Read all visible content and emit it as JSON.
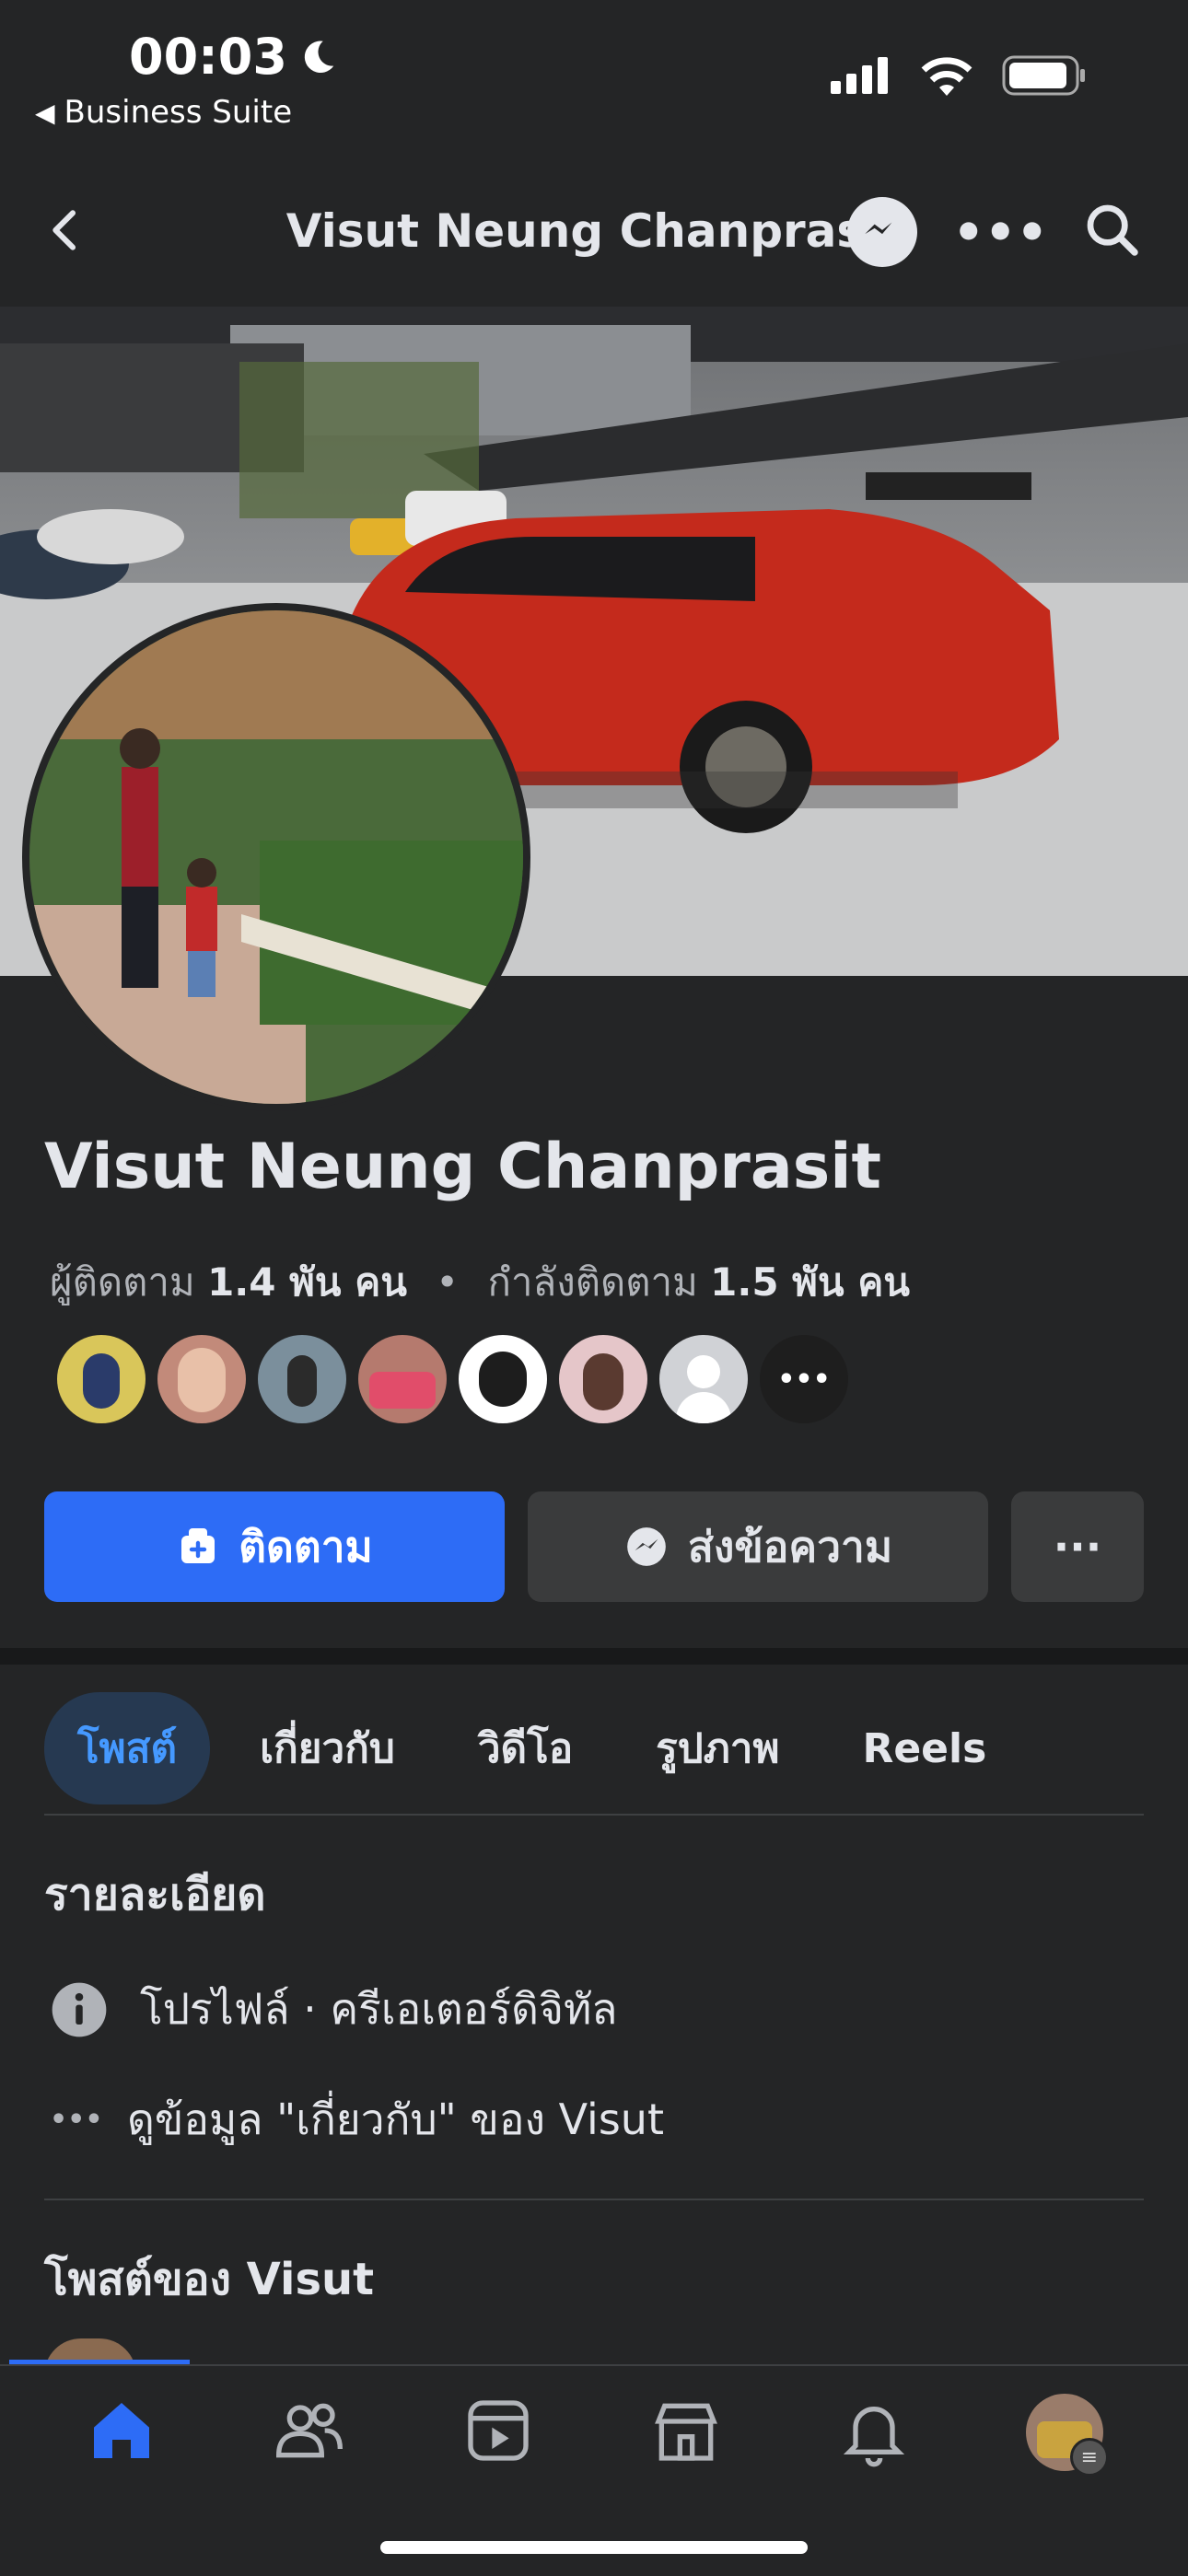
{
  "status_bar": {
    "time": "00:03",
    "back_app": "Business Suite"
  },
  "nav": {
    "title": "Visut Neung Chanprasit"
  },
  "profile": {
    "name": "Visut Neung Chanprasit",
    "followers_label": "ผู้ติดตาม",
    "followers_count": "1.4 พัน คน",
    "following_label": "กำลังติดตาม",
    "following_count": "1.5 พัน คน",
    "separator": "•"
  },
  "actions": {
    "follow": "ติดตาม",
    "message": "ส่งข้อความ",
    "more": "···"
  },
  "tabs": [
    "โพสต์",
    "เกี่ยวกับ",
    "วิดีโอ",
    "รูปภาพ",
    "Reels"
  ],
  "details": {
    "title": "รายละเอียด",
    "profile_line": "โปรไฟล์ · ครีเอเตอร์ดิจิทัล",
    "about_line": "ดูข้อมูล \"เกี่ยวกับ\" ของ Visut"
  },
  "posts_section": {
    "title": "โพสต์ของ Visut"
  },
  "colors": {
    "accent": "#2d6cf6",
    "background": "#242526",
    "text": "#e4e6eb"
  },
  "icons": [
    "moon-icon",
    "signal-icon",
    "wifi-icon",
    "battery-icon",
    "back-chevron-icon",
    "messenger-icon",
    "more-icon",
    "search-icon",
    "info-icon",
    "home-icon",
    "friends-icon",
    "video-icon",
    "marketplace-icon",
    "bell-icon"
  ]
}
